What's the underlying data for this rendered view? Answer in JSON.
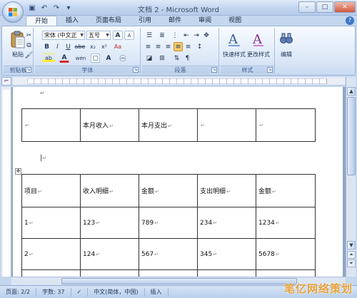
{
  "window": {
    "title": "文档 2 - Microsoft Word",
    "controls": {
      "minimize": "–",
      "maximize": "□",
      "close": "✕"
    }
  },
  "quick_access": [
    {
      "name": "save-icon",
      "glyph": "▣"
    },
    {
      "name": "undo-icon",
      "glyph": "↶"
    },
    {
      "name": "redo-icon",
      "glyph": "↷"
    }
  ],
  "tabs": [
    "开始",
    "插入",
    "页面布局",
    "引用",
    "邮件",
    "审阅",
    "视图"
  ],
  "active_tab": "开始",
  "ribbon": {
    "clipboard": {
      "paste_label": "粘贴",
      "group_label": "剪贴板"
    },
    "font": {
      "font_name": "宋体 (中文正",
      "font_size": "五号",
      "bold": "B",
      "italic": "I",
      "underline": "U",
      "strike": "abe",
      "subscript": "x₂",
      "superscript": "x²",
      "clear_format": "Aa",
      "font_color_letter": "A",
      "highlight_letter": "ab",
      "phonetic": "wén",
      "grow": "A",
      "shrink": "A",
      "group_label": "字体"
    },
    "paragraph": {
      "group_label": "段落"
    },
    "styles": {
      "quick_styles_label": "快速样式",
      "change_styles_label": "更改样式",
      "group_label": "样式"
    },
    "editing": {
      "label": "编辑"
    }
  },
  "document": {
    "para_mark": "↵",
    "table1": {
      "row": [
        "",
        "本月收入",
        "本月支出",
        "",
        ""
      ]
    },
    "table2": {
      "header": [
        "项目",
        "收入明细",
        "金额",
        "支出明细",
        "金额"
      ],
      "rows": [
        [
          "1",
          "123",
          "789",
          "234",
          "1234"
        ],
        [
          "2",
          "124",
          "567",
          "345",
          "5678"
        ]
      ]
    }
  },
  "statusbar": {
    "page": "页面: 2/2",
    "words": "字数: 37",
    "language": "中文(简体，中国)",
    "mode": "插入"
  },
  "watermark": "笔亿网络策划",
  "colors": {
    "ribbon_top": "#f7fbff",
    "ribbon_bottom": "#c9daf1",
    "accent": "#3d78c6"
  }
}
